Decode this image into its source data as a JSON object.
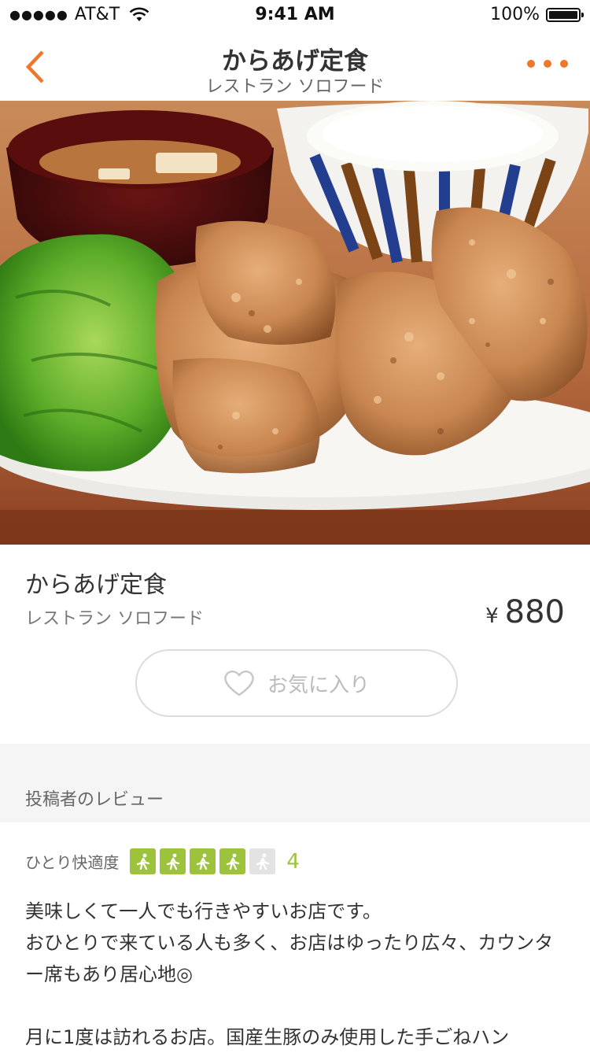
{
  "status_bar": {
    "signal": "●●●●●",
    "carrier": "AT&T",
    "time": "9:41 AM",
    "battery_pct": "100%"
  },
  "nav": {
    "title": "からあげ定食",
    "subtitle": "レストラン ソロフード"
  },
  "dish": {
    "name": "からあげ定食",
    "shop": "レストラン ソロフード",
    "currency": "¥",
    "price": "880"
  },
  "favorite_label": "お気に入り",
  "review_section": {
    "heading": "投稿者のレビュー",
    "rating_label": "ひとり快適度",
    "rating_value": "4",
    "rating_max": 5,
    "lines": [
      "美味しくて一人でも行きやすいお店です。",
      "おひとりで来ている人も多く、お店はゆったり広々、カウンタ",
      "ー席もあり居心地◎",
      "",
      "月に1度は訪れるお店。国産生豚のみ使用した手ごねハン"
    ]
  },
  "colors": {
    "accent": "#f0762a",
    "rating_green": "#9cc33b"
  }
}
